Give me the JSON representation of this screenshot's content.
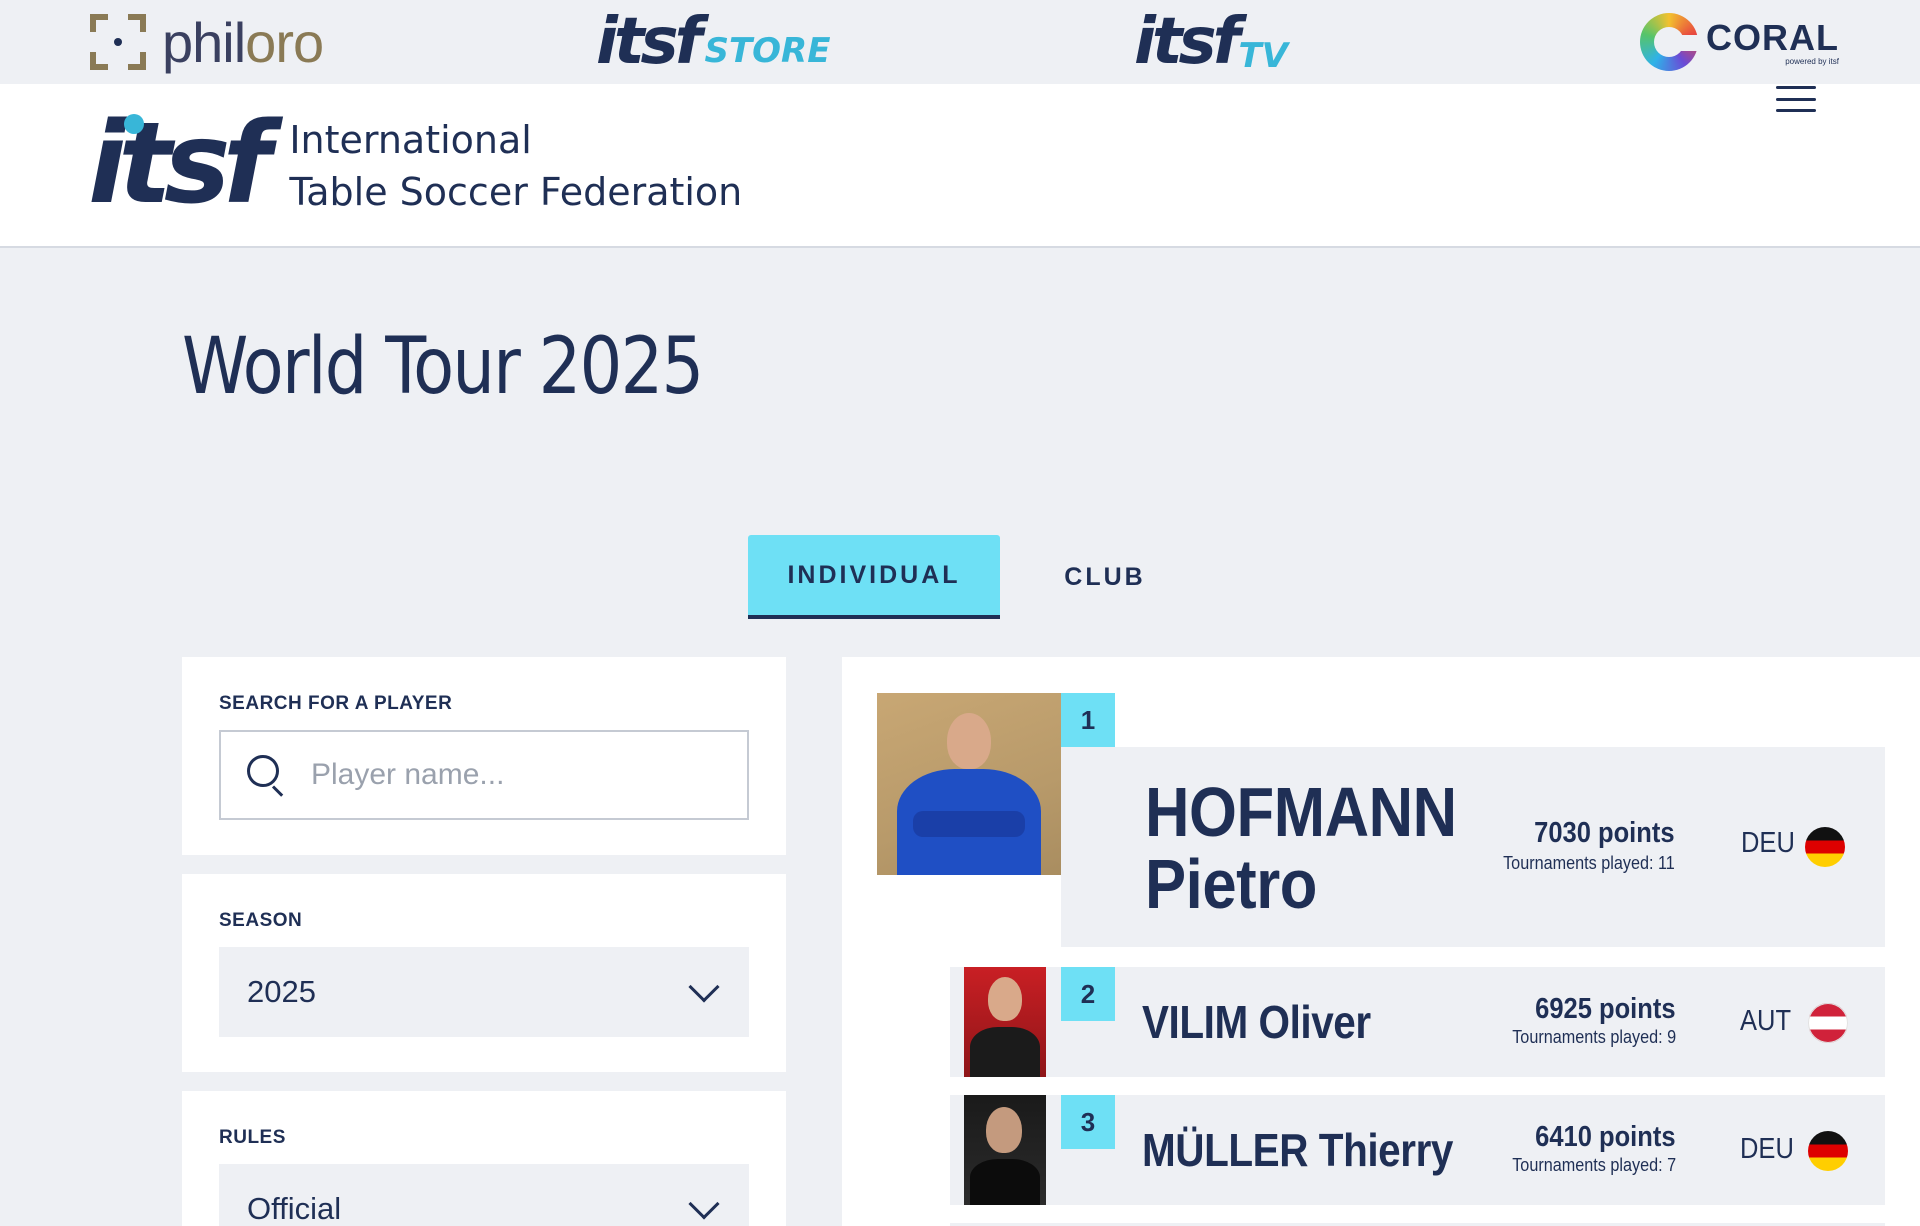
{
  "sponsors": {
    "philoro": {
      "name_main": "phil",
      "name_accent": "oro"
    },
    "itsf_store": {
      "word": "itsf",
      "suffix": "STORE"
    },
    "itsf_tv": {
      "word": "itsf",
      "suffix": "TV"
    },
    "coral": {
      "name": "CORAL",
      "tagline": "powered by itsf"
    }
  },
  "header": {
    "logo_word": "itsf",
    "federation_line1": "International",
    "federation_line2": "Table Soccer Federation",
    "menu_icon": "hamburger-menu-icon"
  },
  "page_title": "World Tour 2025",
  "tabs": [
    {
      "label": "INDIVIDUAL",
      "active": true
    },
    {
      "label": "CLUB",
      "active": false
    }
  ],
  "filters": {
    "search": {
      "label": "SEARCH FOR A PLAYER",
      "placeholder": "Player name...",
      "value": "",
      "icon": "search-icon"
    },
    "season": {
      "label": "SEASON",
      "value": "2025",
      "icon": "chevron-down-icon"
    },
    "rules": {
      "label": "RULES",
      "value": "Official",
      "icon": "chevron-down-icon"
    }
  },
  "ranking": [
    {
      "rank": "1",
      "last_name": "HOFMANN",
      "first_name": "Pietro",
      "points": "7030 points",
      "tournaments": "Tournaments played: 11",
      "country": "DEU",
      "flag": "germany-flag-icon"
    },
    {
      "rank": "2",
      "full_name": "VILIM Oliver",
      "points": "6925 points",
      "tournaments": "Tournaments played: 9",
      "country": "AUT",
      "flag": "austria-flag-icon"
    },
    {
      "rank": "3",
      "full_name": "MÜLLER Thierry",
      "points": "6410 points",
      "tournaments": "Tournaments played: 7",
      "country": "DEU",
      "flag": "germany-flag-icon"
    }
  ],
  "colors": {
    "navy": "#1f2f55",
    "accent_cyan": "#6ee0f5",
    "page_bg": "#eef0f4",
    "card_bg": "#ffffff"
  }
}
